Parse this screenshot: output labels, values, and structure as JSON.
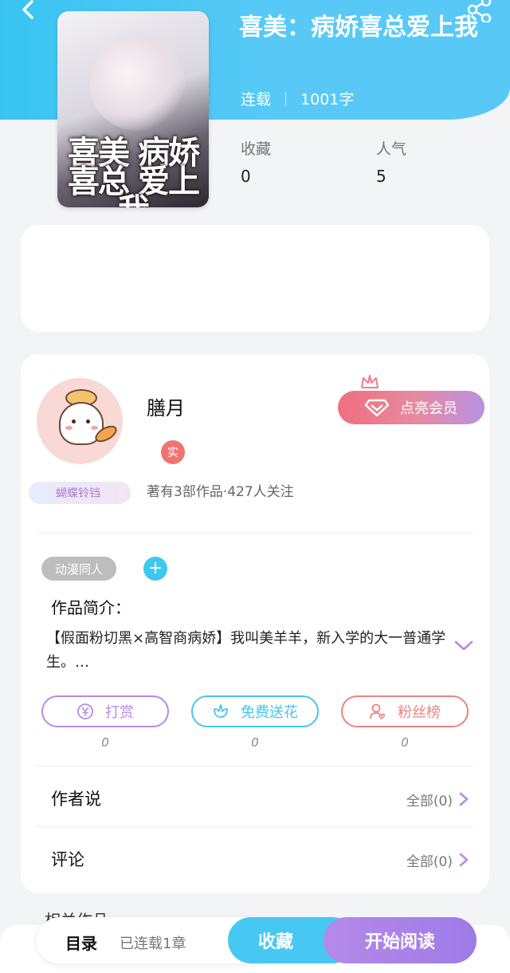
{
  "book": {
    "title": "喜美：病娇喜总爱上我",
    "status": "连载",
    "word_count": "1001字",
    "cover_text": "喜美 病娇喜总 爱上我",
    "stats": [
      {
        "label": "收藏",
        "value": "0"
      },
      {
        "label": "人气",
        "value": "5"
      }
    ]
  },
  "author": {
    "name": "膳月",
    "badge": "蝴蝶铃铛",
    "real_badge": "实",
    "stats": "著有3部作品·427人关注",
    "vip_button": "点亮会员",
    "tag": "动漫同人",
    "tag_add": "+"
  },
  "intro": {
    "label": "作品简介：",
    "text": "【假面粉切黑×高智商病娇】我叫美羊羊，新入学的大一普通学生。…"
  },
  "actions": [
    {
      "label": "打赏",
      "count": "0",
      "color": "#b68be3"
    },
    {
      "label": "免费送花",
      "count": "0",
      "color": "#45c6f0"
    },
    {
      "label": "粉丝榜",
      "count": "0",
      "color": "#ee8383"
    }
  ],
  "rows": [
    {
      "label": "作者说",
      "all": "全部(0)"
    },
    {
      "label": "评论",
      "all": "全部(0)"
    }
  ],
  "related_peek": "相关作品",
  "bottom": {
    "toc": "目录",
    "toc_status": "已连载1章",
    "favorite": "收藏",
    "read": "开始阅读"
  }
}
